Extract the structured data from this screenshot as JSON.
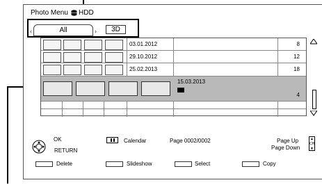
{
  "header": {
    "title": "Photo Menu",
    "drive_label": "HDD"
  },
  "tabs": [
    {
      "label": "All"
    },
    {
      "label": "3D"
    }
  ],
  "groups": [
    {
      "date": "03.01.2012",
      "count": "8"
    },
    {
      "date": "29.10.2012",
      "count": "12"
    },
    {
      "date": "25.02.2013",
      "count": "18"
    },
    {
      "date": "15.03.2013",
      "count": "4"
    }
  ],
  "footer": {
    "ok_label": "OK",
    "return_label": "RETURN",
    "calendar_label": "Calendar",
    "page_label": "Page 0002/0002",
    "page_up_label": "Page Up",
    "page_down_label": "Page Down",
    "ch_label": "CH",
    "buttons": [
      {
        "label": "Delete"
      },
      {
        "label": "Slideshow"
      },
      {
        "label": "Select"
      },
      {
        "label": "Copy"
      }
    ]
  },
  "colors": {
    "selected_row": "#b9b9b9",
    "border": "#555555"
  }
}
